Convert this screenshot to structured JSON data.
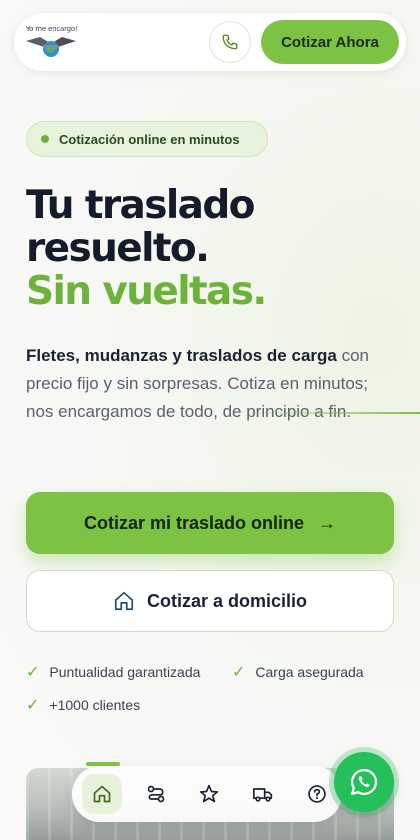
{
  "header": {
    "logo_text": "Yo me encargo!",
    "cta_label": "Cotizar Ahora"
  },
  "hero": {
    "badge": "Cotización online en minutos",
    "title_line1": "Tu traslado",
    "title_line2": "resuelto.",
    "title_accent": "Sin vueltas.",
    "desc_bold": "Fletes, mudanzas y traslados de carga",
    "desc_rest": " con precio fijo y sin sorpresas. Cotiza en minutos; nos encargamos de todo, de principio a fin."
  },
  "actions": {
    "primary_label": "Cotizar mi traslado online",
    "primary_arrow": "→",
    "secondary_label": "Cotizar a domicilio"
  },
  "features": [
    "Puntualidad garantizada",
    "Carga asegurada",
    "+1000 clientes"
  ],
  "bottom_nav": {
    "items": [
      "home-icon",
      "route-icon",
      "star-icon",
      "truck-icon",
      "help-icon"
    ],
    "active": "home-icon"
  },
  "colors": {
    "accent": "#7cc243",
    "accent_dark": "#6cb33a",
    "text": "#141b2b",
    "whatsapp": "#25c05a"
  }
}
